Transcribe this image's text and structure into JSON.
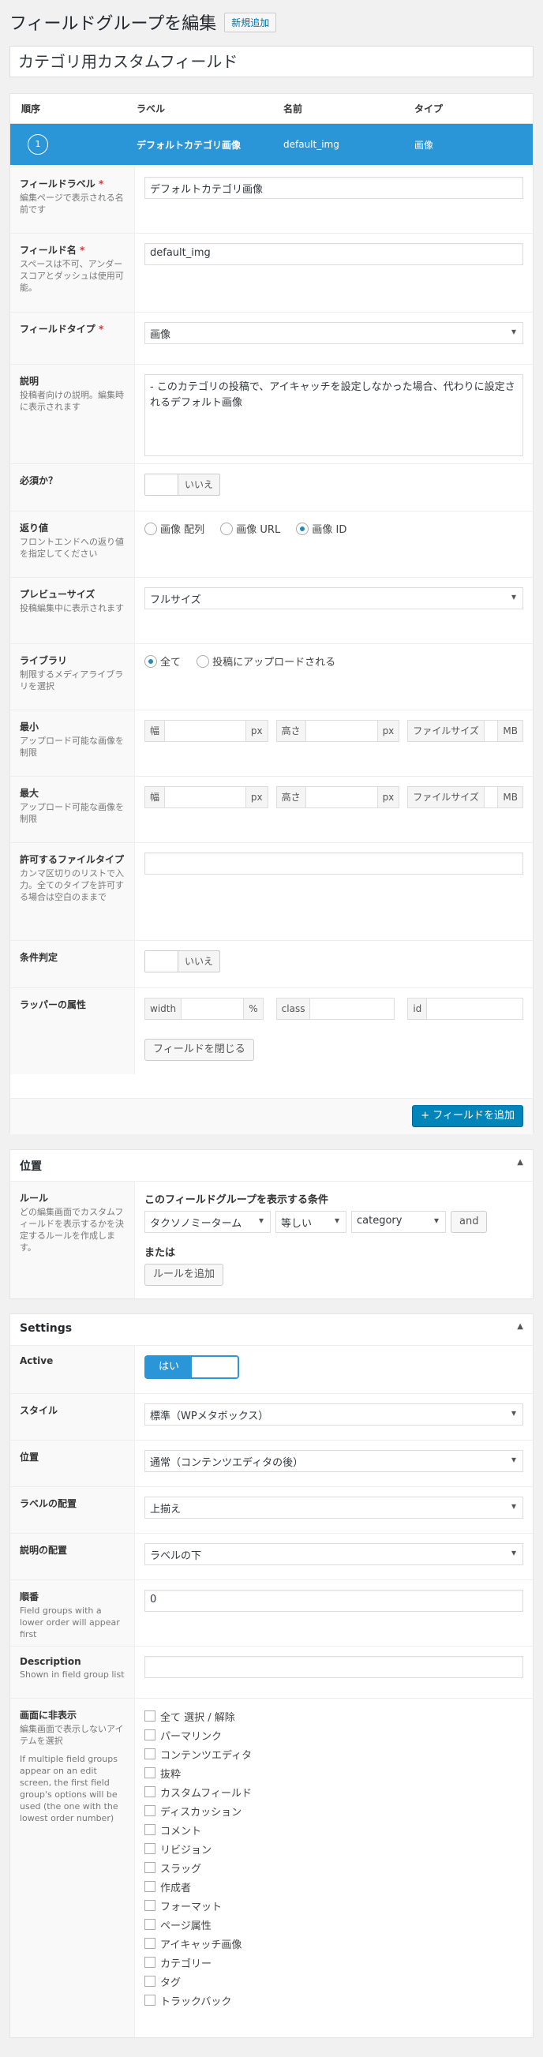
{
  "header": {
    "title": "フィールドグループを編集",
    "add_new": "新規追加"
  },
  "group_title": "カテゴリ用カスタムフィールド",
  "fields_table": {
    "columns": [
      "順序",
      "ラベル",
      "名前",
      "タイプ"
    ],
    "row": {
      "order": "1",
      "label": "デフォルトカテゴリ画像",
      "name": "default_img",
      "type": "画像"
    }
  },
  "field_settings": {
    "label": {
      "title": "フィールドラベル",
      "req": "*",
      "desc": "編集ページで表示される名前です",
      "value": "デフォルトカテゴリ画像"
    },
    "name": {
      "title": "フィールド名",
      "req": "*",
      "desc": "スペースは不可、アンダースコアとダッシュは使用可能。",
      "value": "default_img"
    },
    "type": {
      "title": "フィールドタイプ",
      "req": "*",
      "value": "画像"
    },
    "instructions": {
      "title": "説明",
      "desc": "投稿者向けの説明。編集時に表示されます",
      "value": "- このカテゴリの投稿で、アイキャッチを設定しなかった場合、代わりに設定されるデフォルト画像"
    },
    "required": {
      "title": "必須か？",
      "value": "いいえ"
    },
    "return": {
      "title": "返り値",
      "desc": "フロントエンドへの返り値を指定してください",
      "options": [
        "画像 配列",
        "画像 URL",
        "画像 ID"
      ],
      "selected": "画像 ID"
    },
    "preview": {
      "title": "プレビューサイズ",
      "desc": "投稿編集中に表示されます",
      "value": "フルサイズ"
    },
    "library": {
      "title": "ライブラリ",
      "desc": "制限するメディアライブラリを選択",
      "options": [
        "全て",
        "投稿にアップロードされる"
      ],
      "selected": "全て"
    },
    "min": {
      "title": "最小",
      "desc": "アップロード可能な画像を制限",
      "width": "幅",
      "height": "高さ",
      "px": "px",
      "filesize": "ファイルサイズ",
      "mb": "MB"
    },
    "max": {
      "title": "最大",
      "desc": "アップロード可能な画像を制限",
      "width": "幅",
      "height": "高さ",
      "px": "px",
      "filesize": "ファイルサイズ",
      "mb": "MB"
    },
    "mime": {
      "title": "許可するファイルタイプ",
      "desc": "カンマ区切りのリストで入力。全てのタイプを許可する場合は空白のままで"
    },
    "conditional": {
      "title": "条件判定",
      "value": "いいえ"
    },
    "wrapper": {
      "title": "ラッパーの属性",
      "width": "width",
      "pct": "%",
      "class": "class",
      "id": "id"
    },
    "close": "フィールドを閉じる"
  },
  "add_field": "+ フィールドを追加",
  "location": {
    "heading": "位置",
    "rules_title": "ルール",
    "rules_desc": "どの編集画面でカスタムフィールドを表示するかを決定するルールを作成します。",
    "show_if": "このフィールドグループを表示する条件",
    "param": "タクソノミーターム",
    "operator": "等しい",
    "value": "category",
    "and": "and",
    "or": "または",
    "add_rule": "ルールを追加"
  },
  "settings": {
    "heading": "Settings",
    "active": {
      "title": "Active",
      "value": "はい"
    },
    "style": {
      "title": "スタイル",
      "value": "標準（WPメタボックス）"
    },
    "position": {
      "title": "位置",
      "value": "通常（コンテンツエディタの後）"
    },
    "label_placement": {
      "title": "ラベルの配置",
      "value": "上揃え"
    },
    "instruction_placement": {
      "title": "説明の配置",
      "value": "ラベルの下"
    },
    "order": {
      "title": "順番",
      "desc": "Field groups with a lower order will appear first",
      "value": "0"
    },
    "description": {
      "title": "Description",
      "desc": "Shown in field group list"
    },
    "hide": {
      "title": "画面に非表示",
      "desc": "編集画面で表示しないアイテムを選択",
      "note": "If multiple field groups appear on an edit screen, the first field group's options will be used (the one with the lowest order number)",
      "items": [
        "全て 選択 / 解除",
        "パーマリンク",
        "コンテンツエディタ",
        "抜粋",
        "カスタムフィールド",
        "ディスカッション",
        "コメント",
        "リビジョン",
        "スラッグ",
        "作成者",
        "フォーマット",
        "ページ属性",
        "アイキャッチ画像",
        "カテゴリー",
        "タグ",
        "トラックバック"
      ]
    }
  },
  "icons": {
    "collapse": "triangle-up-icon",
    "select": "chevron-down-icon"
  },
  "colors": {
    "accent": "#2a95d7",
    "primary_button": "#0085ba",
    "required": "#dc3232"
  }
}
